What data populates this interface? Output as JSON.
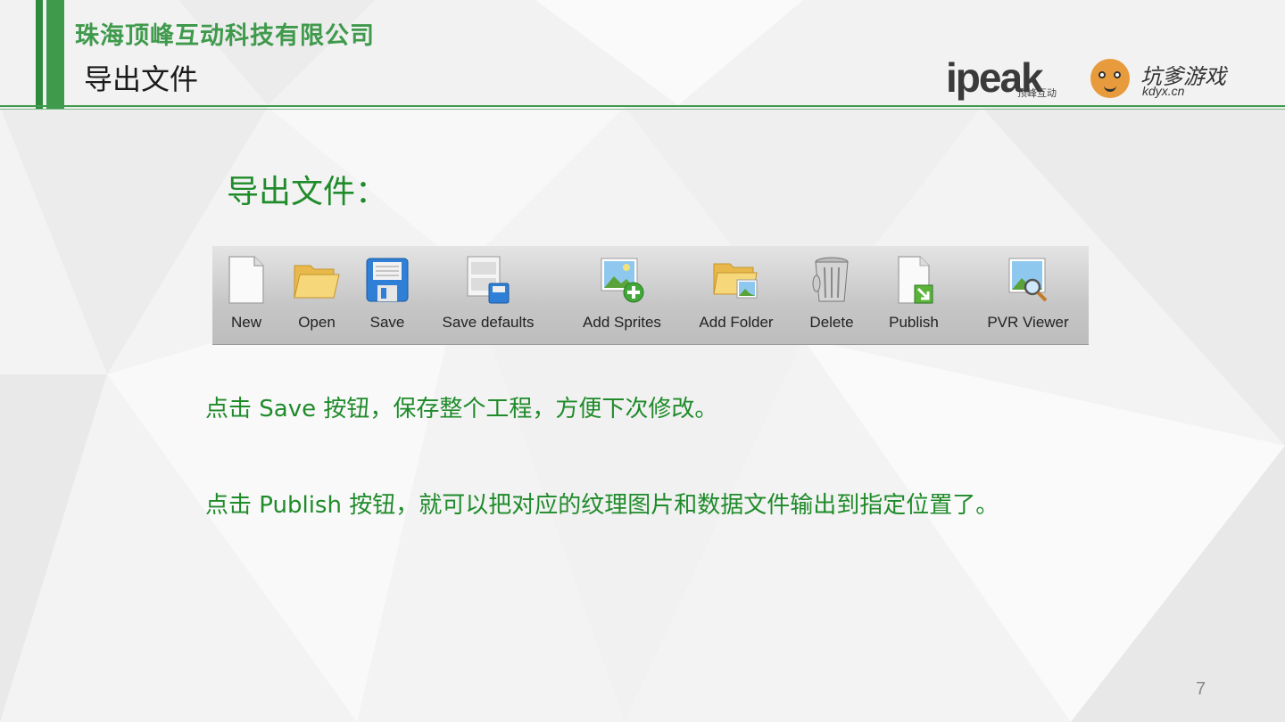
{
  "header": {
    "company": "珠海顶峰互动科技有限公司",
    "title": "导出文件"
  },
  "logos": {
    "ipeak": {
      "text": "ipeak",
      "sub": "顶峰互动"
    },
    "kdyx": {
      "name": "坑爹游戏",
      "url": "kdyx.cn"
    }
  },
  "section_title": "导出文件：",
  "toolbar": {
    "items": [
      {
        "label": "New",
        "icon": "new-document-icon"
      },
      {
        "label": "Open",
        "icon": "open-folder-icon"
      },
      {
        "label": "Save",
        "icon": "save-disk-icon"
      },
      {
        "label": "Save defaults",
        "icon": "save-defaults-icon"
      },
      {
        "label": "Add Sprites",
        "icon": "add-sprites-icon"
      },
      {
        "label": "Add Folder",
        "icon": "add-folder-icon"
      },
      {
        "label": "Delete",
        "icon": "trash-can-icon"
      },
      {
        "label": "Publish",
        "icon": "publish-icon"
      },
      {
        "label": "PVR Viewer",
        "icon": "pvr-viewer-icon"
      }
    ]
  },
  "paragraphs": [
    "点击 Save 按钮，保存整个工程，方便下次修改。",
    "点击 Publish 按钮，就可以把对应的纹理图片和数据文件输出到指定位置了。"
  ],
  "page_number": "7",
  "colors": {
    "accent": "#3f9a4c",
    "text_green": "#1f8b2a"
  }
}
